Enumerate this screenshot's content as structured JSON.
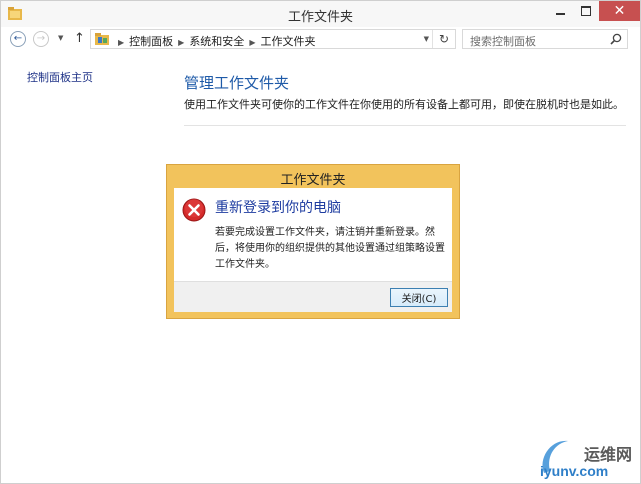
{
  "window": {
    "title": "工作文件夹"
  },
  "nav": {
    "breadcrumbs": [
      "控制面板",
      "系统和安全",
      "工作文件夹"
    ],
    "search_placeholder": "搜索控制面板"
  },
  "sidebar": {
    "home_link": "控制面板主页"
  },
  "main": {
    "title": "管理工作文件夹",
    "description": "使用工作文件夹可使你的工作文件在你使用的所有设备上都可用，即使在脱机时也是如此。"
  },
  "dialog": {
    "title": "工作文件夹",
    "heading": "重新登录到你的电脑",
    "body": "若要完成设置工作文件夹，请注销并重新登录。然后，将使用你的组织提供的其他设置通过组策略设置工作文件夹。",
    "close_label": "关闭(C)"
  },
  "watermark": {
    "brand": "运维网",
    "url": "iyunv.com"
  },
  "colors": {
    "dialog_frame": "#f2c35c",
    "link_blue": "#1e5aa8",
    "close_red": "#c75050"
  }
}
